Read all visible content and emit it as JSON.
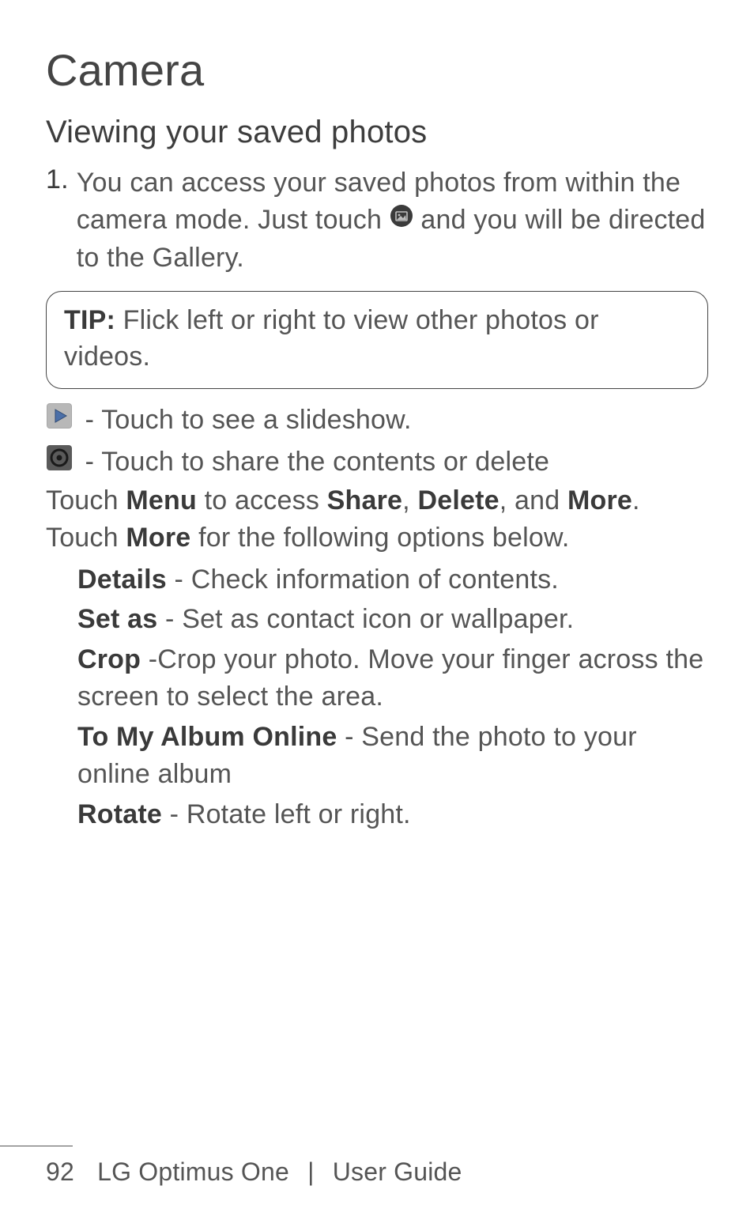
{
  "title": "Camera",
  "subtitle": "Viewing your saved photos",
  "step": {
    "num": "1.",
    "text_a": "You can access your saved photos from within the camera mode. Just touch ",
    "text_b": " and you will be directed to the Gallery."
  },
  "tip": {
    "label": "TIP:",
    "text": " Flick left or right to view other photos or videos."
  },
  "icons": {
    "gallery_icon": "gallery-icon",
    "play_icon": "play-icon",
    "options_icon": "options-icon"
  },
  "icon_lines": {
    "play": " - Touch to see a slideshow.",
    "options": " - Touch to share the contents or delete"
  },
  "menu_line": {
    "a": "Touch ",
    "menu": "Menu",
    "b": " to access ",
    "share": "Share",
    "c": ", ",
    "delete": "Delete",
    "d": ", and ",
    "more": "More",
    "e": "."
  },
  "more_line": {
    "a": "Touch ",
    "more": "More",
    "b": " for the following options below."
  },
  "options": {
    "details": {
      "label": "Details",
      "text": " - Check information of contents."
    },
    "setas": {
      "label": "Set as",
      "text": " - Set as contact icon or wallpaper."
    },
    "crop": {
      "label": "Crop",
      "text": " -Crop your photo. Move your finger across the screen to select the area."
    },
    "album": {
      "label": "To My Album Online",
      "text": " - Send the photo to your online album"
    },
    "rotate": {
      "label": "Rotate",
      "text": " - Rotate left or right."
    }
  },
  "footer": {
    "page": "92",
    "product": "LG Optimus One",
    "sep": "|",
    "doc": "User Guide"
  }
}
